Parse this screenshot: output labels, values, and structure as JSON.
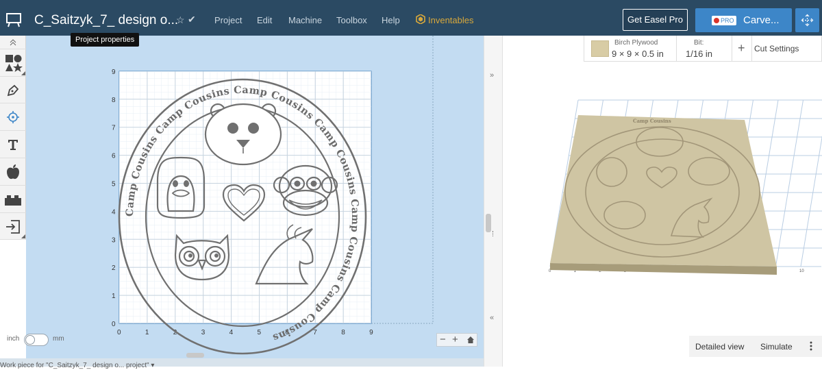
{
  "header": {
    "project_title": "C_Saitzyk_7_ design o...",
    "menu": [
      "Project",
      "Edit",
      "Machine",
      "Toolbox",
      "Help"
    ],
    "inventables_label": "Inventables",
    "get_pro_label": "Get Easel Pro",
    "pro_badge": "PRO",
    "carve_label": "Carve...",
    "tooltip": "Project properties"
  },
  "tools": [
    "shapes-icon",
    "pen-icon",
    "target-icon",
    "text-icon",
    "apple-icon",
    "lego-icon",
    "import-icon"
  ],
  "canvas": {
    "x_ticks": [
      "0",
      "1",
      "2",
      "3",
      "4",
      "5",
      "6",
      "7",
      "8",
      "9"
    ],
    "y_ticks": [
      "0",
      "1",
      "2",
      "3",
      "4",
      "5",
      "6",
      "7",
      "8",
      "9"
    ],
    "ring_text": "Camp Cousins Camp Cousins Camp Cousins Camp Cousins Camp Cousins Camp Cousins",
    "units_left": "inch",
    "units_right": "mm",
    "zoom_minus": "−",
    "zoom_plus": "+",
    "status_text": "Work piece for \"C_Saitzyk_7_ design o... project\" ▾"
  },
  "material_bar": {
    "material_name": "Birch Plywood",
    "material_size": "9 × 9 × 0.5 in",
    "bit_label": "Bit:",
    "bit_value": "1/16 in",
    "add_label": "+",
    "cut_settings_label": "Cut Settings"
  },
  "preview": {
    "x_ticks": [
      "0",
      "1",
      "2",
      "3",
      "4",
      "5",
      "6",
      "7",
      "8",
      "9",
      "10"
    ],
    "detailed_view_label": "Detailed view",
    "simulate_label": "Simulate"
  },
  "colors": {
    "header_bg": "#2b4a63",
    "carve_blue": "#3d86c8",
    "canvas_bg": "#c3dcf2",
    "design_stroke": "#707070",
    "wood": "#cfc5a3"
  }
}
